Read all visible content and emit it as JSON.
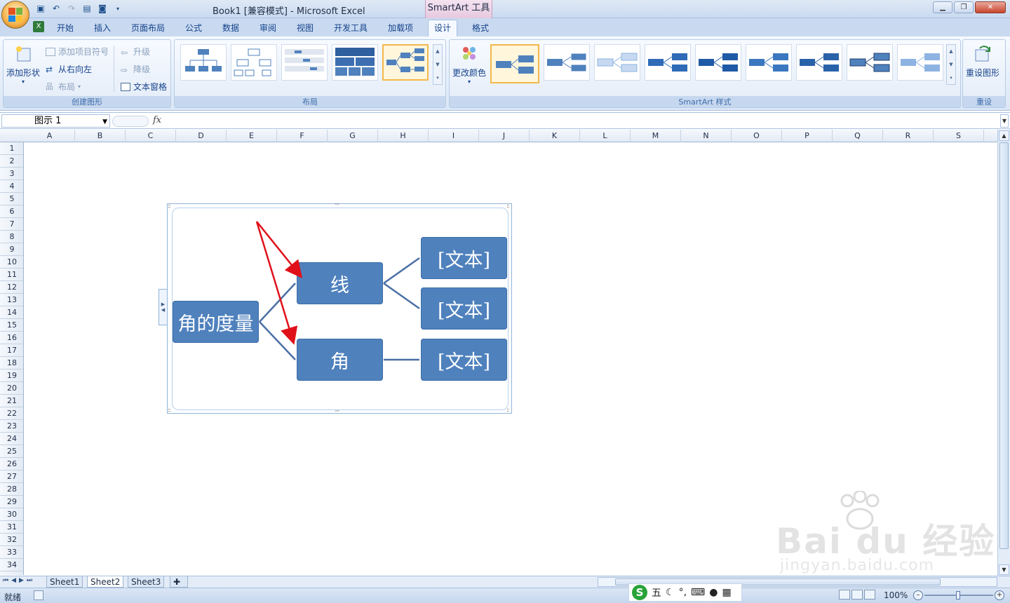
{
  "window": {
    "title": "Book1  [兼容模式] - Microsoft Excel",
    "context_tab_title": "SmartArt 工具"
  },
  "tabs": [
    "开始",
    "插入",
    "页面布局",
    "公式",
    "数据",
    "审阅",
    "视图",
    "开发工具",
    "加载项",
    "设计",
    "格式"
  ],
  "active_tab": "设计",
  "ribbon": {
    "create_group": {
      "label": "创建图形",
      "add_shape": "添加形状",
      "add_bullet": "添加项目符号",
      "right_to_left": "从右向左",
      "layout": "布局",
      "promote": "升级",
      "demote": "降级",
      "text_pane": "文本窗格"
    },
    "layout_group": {
      "label": "布局"
    },
    "styles_group": {
      "label": "SmartArt 样式",
      "change_colors": "更改颜色"
    },
    "reset_group": {
      "label": "重设",
      "reset_graphic": "重设图形"
    }
  },
  "formula_bar": {
    "name_box": "图示 1",
    "fx": "fx",
    "formula": ""
  },
  "columns": [
    "A",
    "B",
    "C",
    "D",
    "E",
    "F",
    "G",
    "H",
    "I",
    "J",
    "K",
    "L",
    "M",
    "N",
    "O",
    "P",
    "Q",
    "R",
    "S"
  ],
  "rows": [
    "1",
    "2",
    "3",
    "4",
    "5",
    "6",
    "7",
    "8",
    "9",
    "10",
    "11",
    "12",
    "13",
    "14",
    "15",
    "16",
    "17",
    "18",
    "19",
    "20",
    "21",
    "22",
    "23",
    "24",
    "25",
    "26",
    "27",
    "28",
    "29",
    "30",
    "31",
    "32",
    "33",
    "34"
  ],
  "smartart": {
    "root": "角的度量",
    "level1": [
      "线",
      "角"
    ],
    "level2": [
      "[文本]",
      "[文本]",
      "[文本]"
    ],
    "node_color": "#4f81bd",
    "annotation_arrow_color": "#e0101a"
  },
  "sheet_tabs": [
    "Sheet1",
    "Sheet2",
    "Sheet3"
  ],
  "active_sheet": "Sheet2",
  "status": {
    "ready": "就绪",
    "zoom": "100%"
  },
  "ime": {
    "mode": "五"
  },
  "watermark": {
    "brand": "Bai du 经验",
    "url": "jingyan.baidu.com"
  }
}
